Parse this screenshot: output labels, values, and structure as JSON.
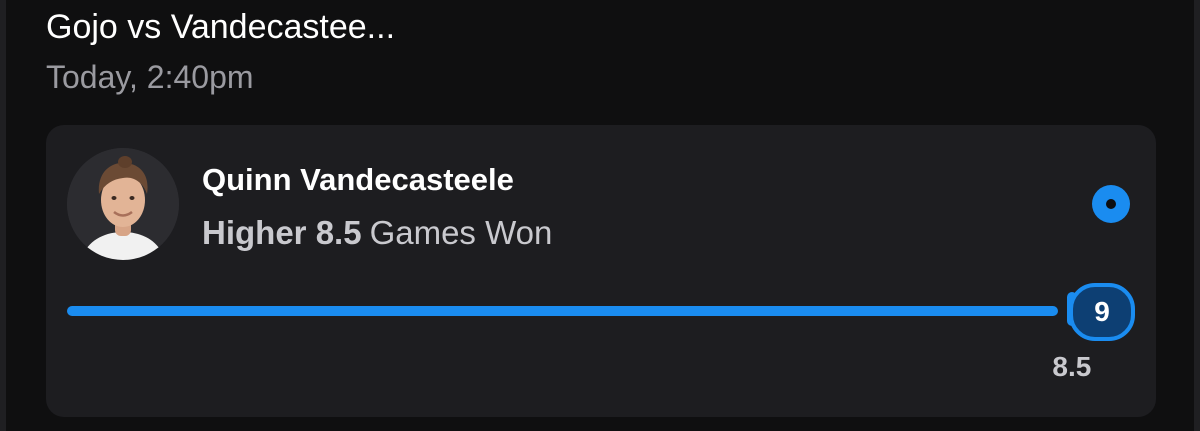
{
  "match": {
    "title": "Gojo vs Vandecastee...",
    "time": "Today, 2:40pm"
  },
  "pick": {
    "player_name": "Quinn Vandecasteele",
    "direction": "Higher",
    "line": "8.5",
    "stat": "Games Won",
    "selected": true
  },
  "progress": {
    "line_value": 8.5,
    "actual_value": 9,
    "actual_label": "9",
    "line_label": "8.5",
    "max_value": 9
  },
  "colors": {
    "accent": "#1a8cf0",
    "background": "#0f0f10",
    "card": "#1d1d20",
    "muted_text": "#9a9aa0"
  },
  "icons": {
    "avatar": "player-photo",
    "radio": "selected-radio-icon"
  }
}
